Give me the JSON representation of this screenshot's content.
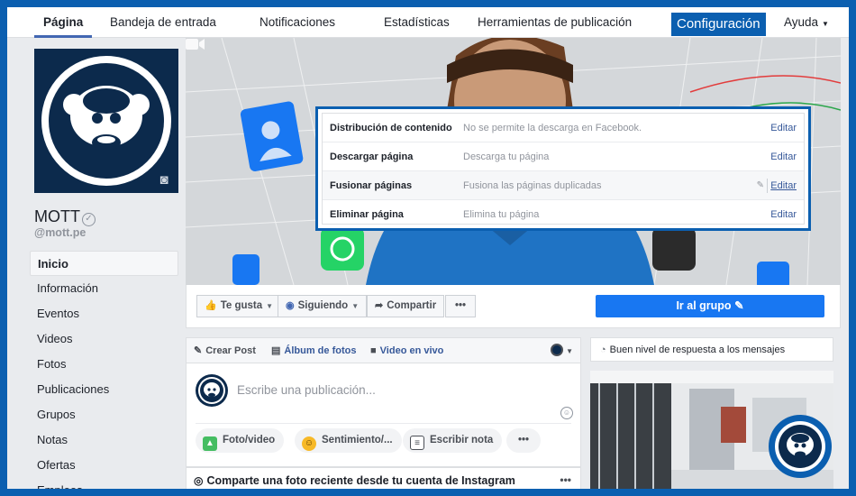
{
  "topnav": {
    "tabs": [
      {
        "label": "Página",
        "active": true
      },
      {
        "label": "Bandeja de entrada"
      },
      {
        "label": "Notificaciones"
      },
      {
        "label": "Estadísticas"
      },
      {
        "label": "Herramientas de publicación"
      },
      {
        "label": "Configuración",
        "highlighted": true
      },
      {
        "label": "Ayuda"
      }
    ]
  },
  "profile": {
    "name": "MOTT",
    "handle": "@mott.pe",
    "brand_color": "#0c2a4c"
  },
  "sidenav": {
    "items": [
      {
        "label": "Inicio",
        "active": true
      },
      {
        "label": "Información"
      },
      {
        "label": "Eventos"
      },
      {
        "label": "Videos"
      },
      {
        "label": "Fotos"
      },
      {
        "label": "Publicaciones"
      },
      {
        "label": "Grupos"
      },
      {
        "label": "Notas"
      },
      {
        "label": "Ofertas"
      },
      {
        "label": "Empleos"
      }
    ]
  },
  "settings_popup": {
    "rows": [
      {
        "label": "Distribución de contenido",
        "description": "No se permite la descarga en Facebook.",
        "action": "Editar"
      },
      {
        "label": "Descargar página",
        "description": "Descarga tu página",
        "action": "Editar"
      },
      {
        "label": "Fusionar páginas",
        "description": "Fusiona las páginas duplicadas",
        "action": "Editar"
      },
      {
        "label": "Eliminar página",
        "description": "Elimina tu página",
        "action": "Editar"
      }
    ]
  },
  "actionbar": {
    "like": "Te gusta",
    "following": "Siguiendo",
    "share": "Compartir",
    "more": "•••",
    "group": "Ir al grupo"
  },
  "composer": {
    "create_post": "Crear Post",
    "album": "Álbum de fotos",
    "live": "Video en vivo",
    "placeholder": "Escribe una publicación...",
    "photo_video": "Foto/video",
    "feeling": "Sentimiento/...",
    "note": "Escribir nota",
    "more": "•••"
  },
  "instagram": {
    "title": "Comparte una foto reciente desde tu cuenta de Instagram",
    "more": "•••"
  },
  "response": {
    "text": "Buen nivel de respuesta a los mensajes"
  },
  "colors": {
    "accent": "#0b5fb0",
    "fb_blue": "#1877f2",
    "link": "#365899"
  }
}
